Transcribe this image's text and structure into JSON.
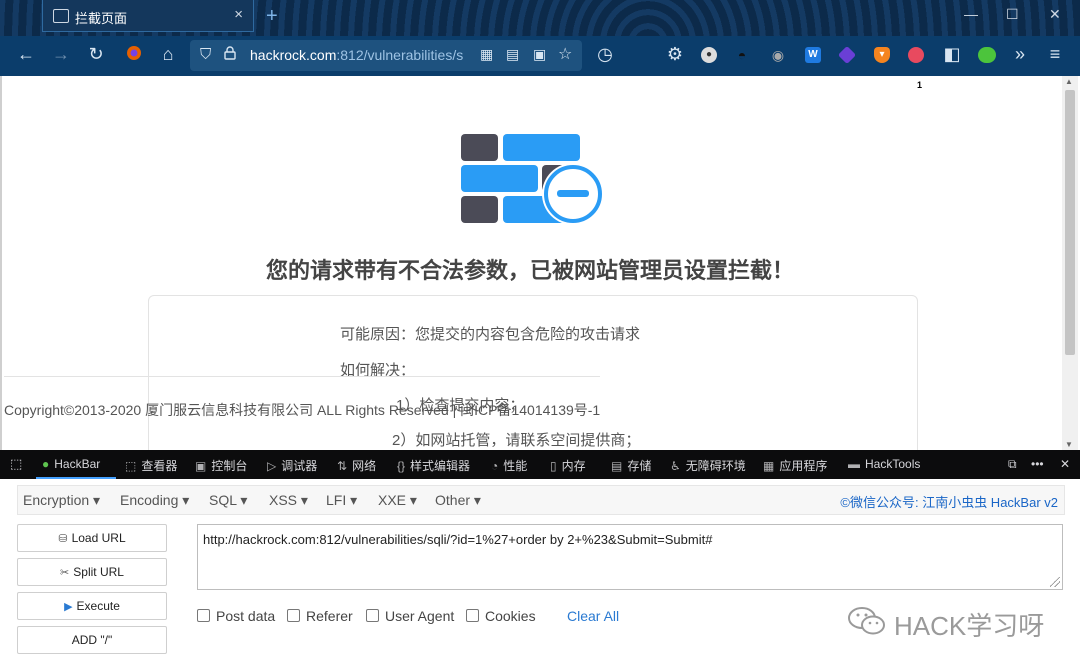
{
  "browser": {
    "tab_title": "拦截页面",
    "tab_close": "×",
    "new_tab": "+",
    "window_controls": [
      "—",
      "☐",
      "✕"
    ],
    "url_host": "hackrock.com",
    "url_rest": ":812/vulnerabilities/s",
    "extension_badge": "1"
  },
  "page": {
    "headline": "您的请求带有不合法参数，已被网站管理员设置拦截！",
    "reason": "可能原因：您提交的内容包含危险的攻击请求",
    "howto": "如何解决：",
    "step1": "1）检查提交内容；",
    "step2": "2）如网站托管，请联系空间提供商；",
    "copyright": "Copyright©2013-2020 厦门服云信息科技有限公司 ALL Rights Reserved | 闽ICP备14014139号-1"
  },
  "devtools": {
    "tabs": [
      "HackBar",
      "查看器",
      "控制台",
      "调试器",
      "网络",
      "样式编辑器",
      "性能",
      "内存",
      "存储",
      "无障碍环境",
      "应用程序",
      "HackTools"
    ]
  },
  "hackbar": {
    "menus": [
      "Encryption ▾",
      "Encoding ▾",
      "SQL ▾",
      "XSS ▾",
      "LFI ▾",
      "XXE ▾",
      "Other ▾"
    ],
    "promo": "©微信公众号: 江南小虫虫 HackBar v2",
    "buttons": {
      "load": "Load URL",
      "split": "Split URL",
      "execute": "Execute",
      "add": "ADD \"/\""
    },
    "url_value": "http://hackrock.com:812/vulnerabilities/sqli/?id=1%27+order by 2+%23&Submit=Submit#",
    "checkboxes": [
      "Post data",
      "Referer",
      "User Agent",
      "Cookies"
    ],
    "clear_all": "Clear All"
  },
  "watermark": "HACK学习呀",
  "colors": {
    "accent_blue": "#2a9cf5",
    "dark_block": "#4b4b57",
    "titlebar": "#0c2a4a",
    "navbar": "#0b3d6b"
  }
}
